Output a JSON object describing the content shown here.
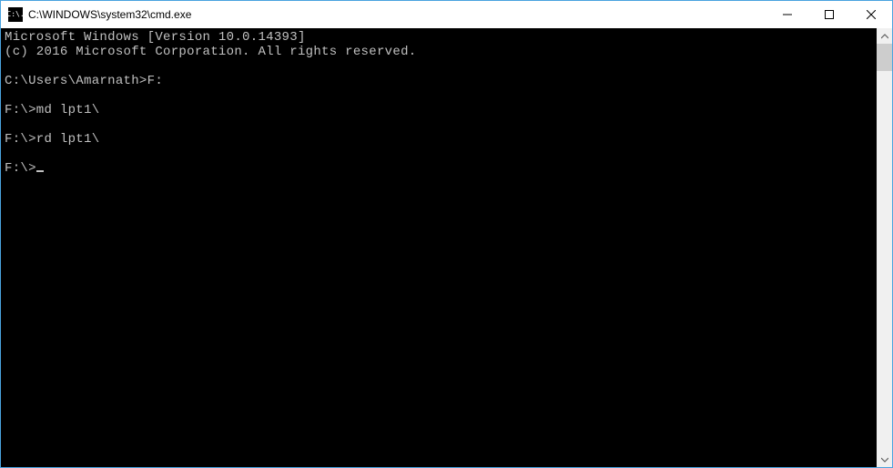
{
  "window": {
    "title": "C:\\WINDOWS\\system32\\cmd.exe",
    "icon_label": "C:\\."
  },
  "terminal": {
    "lines": [
      "Microsoft Windows [Version 10.0.14393]",
      "(c) 2016 Microsoft Corporation. All rights reserved.",
      "",
      "C:\\Users\\Amarnath>F:",
      "",
      "F:\\>md lpt1\\",
      "",
      "F:\\>rd lpt1\\",
      "",
      "F:\\>"
    ]
  }
}
